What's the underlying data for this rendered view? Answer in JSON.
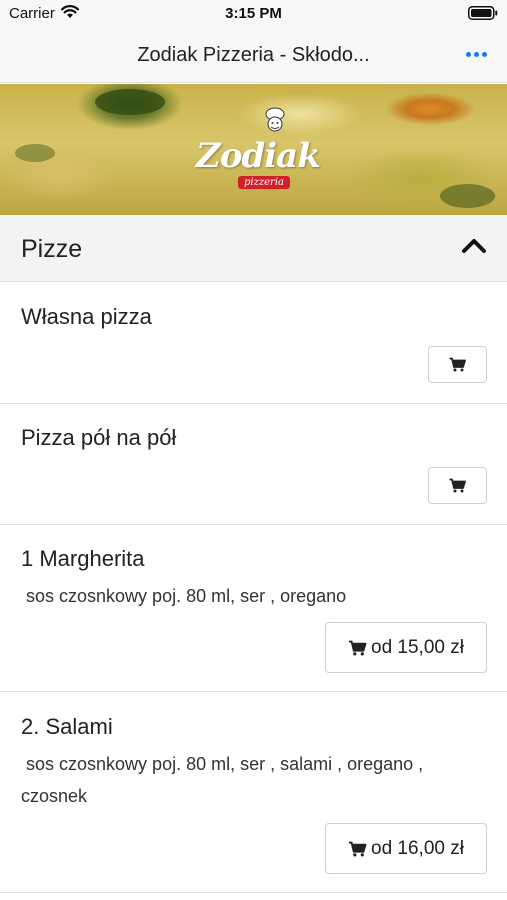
{
  "status_bar": {
    "carrier": "Carrier",
    "time": "3:15 PM"
  },
  "nav": {
    "title": "Zodiak Pizzeria - Skłodo..."
  },
  "banner": {
    "logo_text": "Zodiak",
    "logo_sub": "pizzeria"
  },
  "category": {
    "title": "Pizze",
    "expanded": true
  },
  "items": [
    {
      "name": "Własna pizza",
      "description": "",
      "price": ""
    },
    {
      "name": "Pizza pół na pół",
      "description": "",
      "price": ""
    },
    {
      "name": "1 Margherita",
      "description": " sos czosnkowy poj. 80 ml, ser , oregano",
      "price": "od 15,00 zł"
    },
    {
      "name": "2. Salami",
      "description": " sos czosnkowy poj. 80 ml, ser , salami , oregano , czosnek",
      "price": "od 16,00 zł"
    }
  ],
  "colors": {
    "accent": "#1a7cf5",
    "logo_sub_bg": "#d2202a"
  },
  "icons": [
    "wifi-icon",
    "battery-icon",
    "more-icon",
    "chevron-up-icon",
    "cart-icon"
  ]
}
